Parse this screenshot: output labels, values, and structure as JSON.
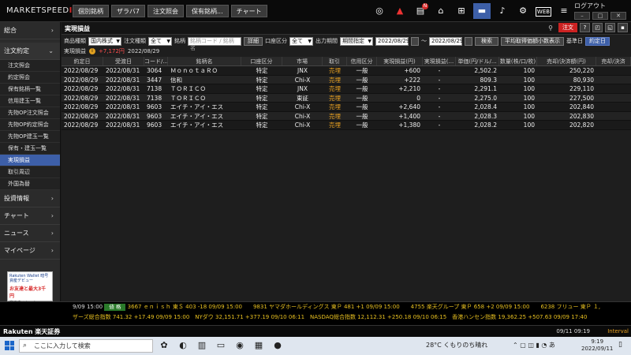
{
  "app": {
    "logo_text": "MARKETSPEED",
    "logo_suffix": "II",
    "top_tabs": [
      "個別銘柄",
      "ザラバ7",
      "注文照会",
      "保有銘柄...",
      "チャート"
    ],
    "web_label": "WEB",
    "logout": "ログアウト"
  },
  "sidebar": {
    "sections": [
      {
        "label": "総合",
        "chev": "›"
      },
      {
        "label": "注文約定",
        "chev": "⌄"
      }
    ],
    "items": [
      "注文照会",
      "約定照会",
      "保有銘柄一覧",
      "信用建玉一覧",
      "先物OP注文照会",
      "先物OP約定照会",
      "先物OP建玉一覧",
      "保有・建玉一覧",
      "実現損益",
      "取引周辺",
      "外国為替"
    ],
    "selected": "実現損益",
    "lower_sections": [
      {
        "label": "投資情報",
        "chev": "›"
      },
      {
        "label": "チャート",
        "chev": "›"
      },
      {
        "label": "ニュース",
        "chev": "›"
      },
      {
        "label": "マイページ",
        "chev": "›"
      }
    ],
    "banner": {
      "line1": "Rakuten Wallet 暗号資産デビュー",
      "line2": "お友達と最大3千円",
      "line3": "楽天ウォレット"
    }
  },
  "panel": {
    "title": "実現損益",
    "order_label": "注文",
    "filters": {
      "product_label": "商品種類",
      "product_value": "国内株式",
      "order_type_label": "注文種類",
      "order_type_value": "全て",
      "stock_label": "銘柄",
      "stock_placeholder": "銘柄コード / 銘柄名",
      "detail_button": "詳細",
      "account_label": "口座区分",
      "account_value": "全て",
      "period_label": "出力期間",
      "period_value": "期間指定",
      "date_from": "2022/08/29",
      "date_sep": "～",
      "date_to": "2022/08/29",
      "search_button": "検索",
      "avg_button": "平均取得価額小数表示",
      "base_label": "基準日",
      "base_button": "約定日"
    },
    "summary": {
      "label": "実現損益",
      "info": "i",
      "value": "+7,172円",
      "date": "2022/08/29"
    }
  },
  "table": {
    "headers": [
      "約定日",
      "受渡日",
      "コード/...",
      "銘柄名",
      "口座区分",
      "市場",
      "取引",
      "信用区分",
      "実現損益(円)",
      "実現損益(...",
      "単価(円/ドル/...",
      "数量(株/口/枚)",
      "売却/決済額(円)",
      "売却/決済"
    ],
    "rows": [
      [
        "2022/08/29",
        "2022/08/31",
        "3064",
        "ＭｏｎｏｔａＲＯ",
        "特定",
        "JNX",
        "売埋",
        "一般",
        "+600",
        "-",
        "2,502.2",
        "100",
        "250,220",
        ""
      ],
      [
        "2022/08/29",
        "2022/08/31",
        "3447",
        "信和",
        "特定",
        "Chi-X",
        "売埋",
        "一般",
        "+222",
        "-",
        "809.3",
        "100",
        "80,930",
        ""
      ],
      [
        "2022/08/29",
        "2022/08/31",
        "7138",
        "ＴＯＲＩＣＯ",
        "特定",
        "JNX",
        "売埋",
        "一般",
        "+2,210",
        "-",
        "2,291.1",
        "100",
        "229,110",
        ""
      ],
      [
        "2022/08/29",
        "2022/08/31",
        "7138",
        "ＴＯＲＩＣＯ",
        "特定",
        "東証",
        "売埋",
        "一般",
        "0",
        "-",
        "2,275.0",
        "100",
        "227,500",
        ""
      ],
      [
        "2022/08/29",
        "2022/08/31",
        "9603",
        "エイチ・アイ・エス",
        "特定",
        "Chi-X",
        "売埋",
        "一般",
        "+2,640",
        "-",
        "2,028.4",
        "100",
        "202,840",
        ""
      ],
      [
        "2022/08/29",
        "2022/08/31",
        "9603",
        "エイチ・アイ・エス",
        "特定",
        "Chi-X",
        "売埋",
        "一般",
        "+1,400",
        "-",
        "2,028.3",
        "100",
        "202,830",
        ""
      ],
      [
        "2022/08/29",
        "2022/08/31",
        "9603",
        "エイチ・アイ・エス",
        "特定",
        "Chi-X",
        "売埋",
        "一般",
        "+1,380",
        "-",
        "2,028.2",
        "100",
        "202,820",
        ""
      ]
    ],
    "pnl_colors": [
      "green",
      "red",
      "red",
      "white",
      "red",
      "red",
      "red"
    ]
  },
  "ticker": {
    "row1_time": "9/09 15:00",
    "row1_badge": "値 格",
    "row1_text": "3667 ｅｎｉｓｈ 東Ｓ 403 -18 09/09 15:00　　9831 ヤマダホールディングス 東Ｐ 481 +1 09/09 15:00　　4755 楽天グループ 東Ｐ 658 +2 09/09 15:00　　6238 フリュー 東Ｐ １,",
    "row2_text": "ザーズ総合指数 741.32 +17.49 09/09 15:00　NYダウ 32,151.71 +377.19 09/10 06:11　NASDAQ総合指数 12,112.31 +250.18 09/10 06:15　香港ハンセン指数 19,362.25 +507.63 09/09 17:40",
    "brand": "Rakuten 楽天証券",
    "clock": "09/11 09:19",
    "interval": "Interval"
  },
  "taskbar": {
    "search_text": "ここに入力して検索",
    "weather": "28°C くもりのち晴れ",
    "time": "9:19",
    "date": "2022/09/11"
  }
}
